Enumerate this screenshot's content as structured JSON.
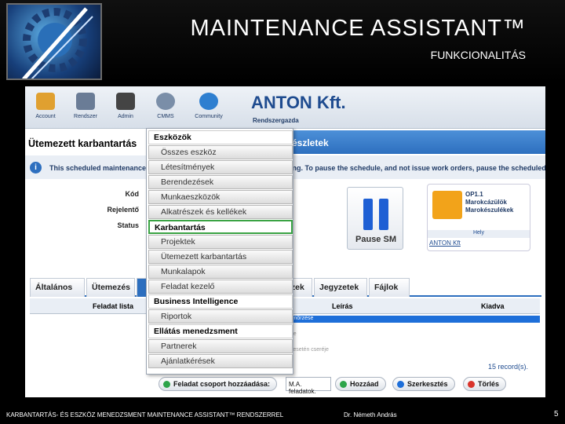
{
  "slide": {
    "title": "MAINTENANCE ASSISTANT™",
    "subtitle": "FUNKCIONALITÁS",
    "footer_left": "KARBANTARTÁS- ÉS ESZKÖZ MENEDZSMENT MAINTENANCE ASSISTANT™ RENDSZERREL",
    "footer_mid": "Dr. Németh András",
    "page_number": "5"
  },
  "toolbar": {
    "items": [
      {
        "label": "Account",
        "icon": "account-icon"
      },
      {
        "label": "Rendszer",
        "icon": "computer-icon"
      },
      {
        "label": "Admin",
        "icon": "tools-icon"
      },
      {
        "label": "CMMS",
        "icon": "gear-icon"
      },
      {
        "label": "Community",
        "icon": "globe-icon"
      }
    ],
    "company": "ANTON Kft.",
    "role": "Rendszergazda"
  },
  "page": {
    "title": "Ütemezett karbantartás",
    "title_right": "észletek",
    "info_pre": "This scheduled maintenance",
    "info_post": "ing. To pause the schedule, and not issue work orders, pause the scheduled maintenance",
    "fields": {
      "kod": "Kód",
      "rejelento": "Rejelentő",
      "status": "Status"
    },
    "pause_label": "Pause SM"
  },
  "card": {
    "line1": "OP1.1",
    "line2": "Marokcázülök",
    "line3": "Marokészulékek",
    "hely": "Hely",
    "link": "ANTON Kft"
  },
  "tabs": [
    "Általános",
    "Ütemezés",
    "",
    "",
    "lkatrészek",
    "Jegyzetek",
    "Fájlok"
  ],
  "grid": {
    "col_task": "Feladat lista",
    "col_desc": "Leírás",
    "col_assign": "Kiadva",
    "rows": [
      "...elfekvő és bázis felületek ellenőrzése",
      "...rzése",
      "...hanikus leszorítók ellenőrzése",
      "...ellenőrzése",
      "...stainek ellenőrzése szükség esetén cseréje"
    ],
    "records": "15 record(s)."
  },
  "actions": {
    "add_group": "Feladat csoport hozzáadása:",
    "select_value": "M.A. feladatok.",
    "add": "Hozzáad",
    "edit": "Szerkesztés",
    "delete": "Törlés"
  },
  "menu": [
    {
      "label": "Eszközök",
      "cat": true
    },
    {
      "label": "Összes eszköz",
      "cat": false
    },
    {
      "label": "Létesítmények",
      "cat": false
    },
    {
      "label": "Berendezések",
      "cat": false
    },
    {
      "label": "Munkaeszközök",
      "cat": false
    },
    {
      "label": "Alkatrészek és kellékek",
      "cat": false
    },
    {
      "label": "Karbantartás",
      "cat": true,
      "hl": true
    },
    {
      "label": "Projektek",
      "cat": false
    },
    {
      "label": "Ütemezett karbantartás",
      "cat": false
    },
    {
      "label": "Munkalapok",
      "cat": false
    },
    {
      "label": "Feladat kezelő",
      "cat": false
    },
    {
      "label": "Business Intelligence",
      "cat": true
    },
    {
      "label": "Riportok",
      "cat": false
    },
    {
      "label": "Ellátás menedzsment",
      "cat": true
    },
    {
      "label": "Partnerek",
      "cat": false
    },
    {
      "label": "Ajánlatkérések",
      "cat": false
    }
  ]
}
